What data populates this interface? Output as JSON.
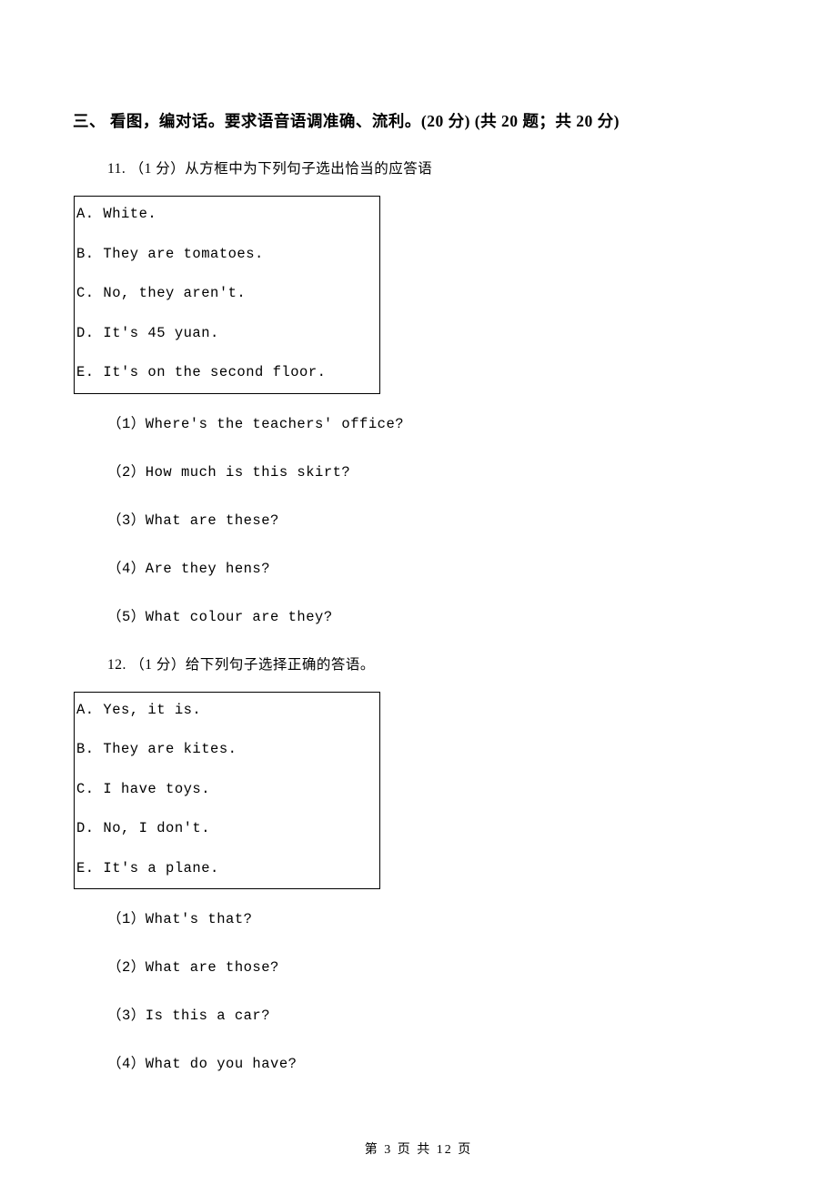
{
  "section": {
    "heading": "三、 看图，编对话。要求语音语调准确、流利。(20 分) (共 20 题；共 20 分)"
  },
  "q11": {
    "intro": "11. （1 分）从方框中为下列句子选出恰当的应答语",
    "options": [
      "A. White.",
      "B. They are tomatoes.",
      "C. No, they aren't.",
      "D. It's 45 yuan.",
      "E. It's on the second floor."
    ],
    "subs": [
      "（1）Where's the teachers' office?",
      "（2）How much is this skirt?",
      "（3）What are these?",
      "（4）Are they hens?",
      "（5）What colour are they?"
    ]
  },
  "q12": {
    "intro": "12. （1 分）给下列句子选择正确的答语。",
    "options": [
      "A. Yes, it is.",
      "B. They are kites.",
      "C. I have toys.",
      "D. No, I don't.",
      "E. It's a plane."
    ],
    "subs": [
      "（1）What's that?",
      "（2）What are those?",
      "（3）Is this a car?",
      "（4）What do you have?"
    ]
  },
  "footer": {
    "text": "第 3 页 共 12 页"
  }
}
